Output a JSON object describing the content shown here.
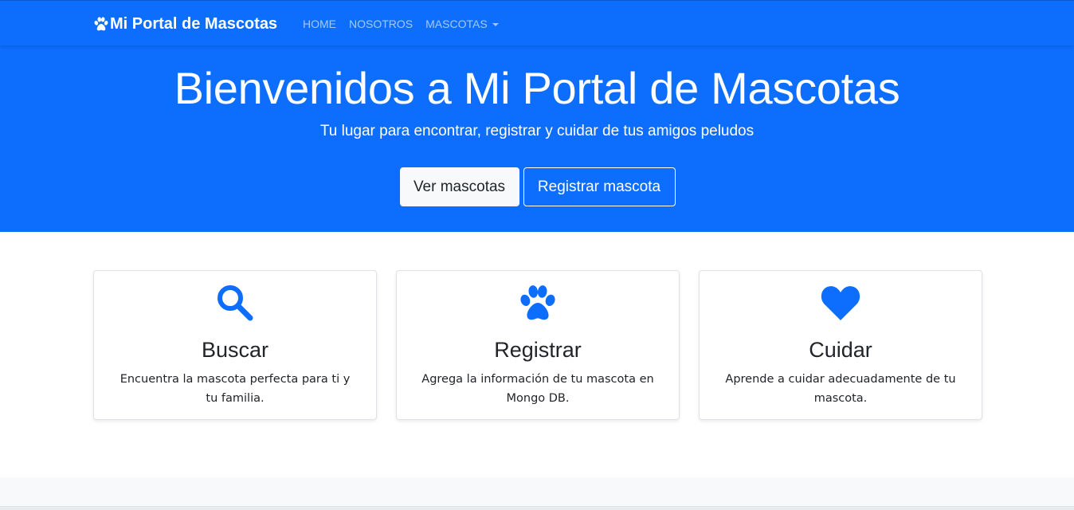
{
  "navbar": {
    "brand": "Mi Portal de Mascotas",
    "brand_icon": "paw-icon",
    "links": [
      {
        "label": "HOME"
      },
      {
        "label": "NOSOTROS"
      },
      {
        "label": "MASCOTAS"
      }
    ]
  },
  "hero": {
    "title": "Bienvenidos a Mi Portal de Mascotas",
    "subtitle": "Tu lugar para encontrar, registrar y cuidar de tus amigos peludos",
    "primary_button": "Ver mascotas",
    "secondary_button": "Registrar mascota"
  },
  "features": [
    {
      "icon": "search-icon",
      "title": "Buscar",
      "text": "Encuentra la mascota perfecta para ti y tu familia."
    },
    {
      "icon": "paw-icon",
      "title": "Registrar",
      "text": "Agrega la información de tu mascota en Mongo DB."
    },
    {
      "icon": "heart-icon",
      "title": "Cuidar",
      "text": "Aprende a cuidar adecuadamente de tu mascota."
    }
  ],
  "colors": {
    "primary": "#0d6efd",
    "light": "#f8f9fa",
    "text": "#212529"
  }
}
